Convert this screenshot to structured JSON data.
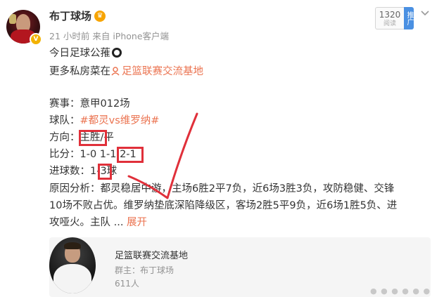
{
  "post": {
    "author": "布丁球场",
    "meta": "21 小时前  来自 iPhone客户端",
    "avatar_badge": "V"
  },
  "stats": {
    "count": "1320",
    "count_label": "阅读",
    "tag": "推广"
  },
  "body": {
    "line1": "今日足球公蓷",
    "line2_prefix": "更多私房菜在",
    "line2_link": "足篮联赛交流基地",
    "event": "赛事：意甲012场",
    "teams_prefix": "球队：",
    "teams_link": "#都灵vs维罗纳#",
    "direction": "方向：主胜/平",
    "score": "比分：1-0 1-1 2-1",
    "goals": "进球数：1-3球",
    "analysis1": "原因分析：都灵稳居中游，主场6胜2平7负，近6场3胜3负，攻防稳健、交锋",
    "analysis2": "10场不败占优。维罗纳垫底深陷降级区，客场2胜5平9负，近6场1胜5负、进",
    "analysis3_prefix": "攻哑火。主队 ... ",
    "expand": "展开"
  },
  "group_card": {
    "title": "足篮联赛交流基地",
    "owner": "群主：布丁球场",
    "members": "611人"
  },
  "colors": {
    "link": "#eb7350",
    "annotation": "#e0303a",
    "crown": "#f7a400"
  }
}
